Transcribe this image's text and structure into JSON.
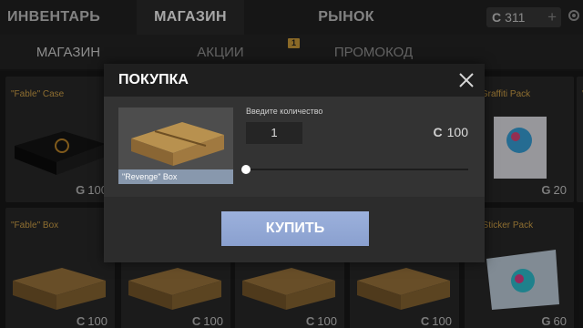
{
  "top_tabs": [
    {
      "label": "ИНВЕНТАРЬ"
    },
    {
      "label": "МАГАЗИН"
    },
    {
      "label": "РЫНОК"
    }
  ],
  "currency": {
    "icon": "currency-coin-icon",
    "symbol": "C",
    "value": "311",
    "add": "+"
  },
  "sub_tabs": [
    {
      "label": "МАГАЗИН"
    },
    {
      "label": "АКЦИИ",
      "badge": "1"
    },
    {
      "label": "ПРОМОКОД"
    }
  ],
  "items": [
    {
      "name": "\"Fable\" Case",
      "price": "100",
      "symbol": "G"
    },
    {
      "name": "\"Fable\" Box",
      "price": "100",
      "symbol": "G"
    },
    {
      "name": "n\" Graffiti Pack",
      "price": "20",
      "symbol": "G"
    },
    {
      "name": "\"F",
      "price": "",
      "symbol": ""
    },
    {
      "name": "\"Fable\" Box",
      "price": "100",
      "symbol": "C"
    },
    {
      "name": "",
      "price": "100",
      "symbol": "C"
    },
    {
      "name": "",
      "price": "100",
      "symbol": "C"
    },
    {
      "name": "",
      "price": "100",
      "symbol": "C"
    },
    {
      "name": "w\" Sticker Pack",
      "price": "60",
      "symbol": "G"
    }
  ],
  "modal": {
    "title": "ПОКУПКА",
    "item_label": "\"Revenge\" Box",
    "qty_label": "Введите количество",
    "qty_value": "1",
    "total_symbol": "C",
    "total_value": "100",
    "slider_value": 0,
    "buy_label": "КУПИТЬ"
  },
  "colors": {
    "accent_gold": "#d9a84a",
    "buy_button": "#9cb1dc",
    "badge": "#d5a23c"
  }
}
